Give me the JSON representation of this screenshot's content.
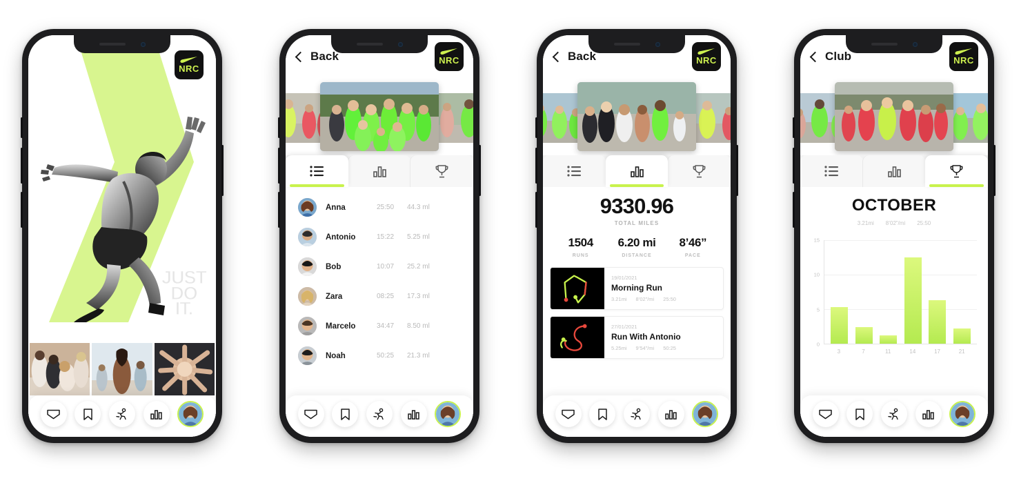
{
  "app": {
    "brand_logo": "nike-nrc-logo",
    "brand_text": "NRC",
    "accent": "#c8f24c",
    "dark": "#111111"
  },
  "screens": [
    {
      "id": "home",
      "hero": {
        "tagline_lines": [
          "JUST",
          "DO",
          "IT."
        ],
        "background_shape": "lime-chevron",
        "image": "runner-sprinting"
      },
      "photo_strip": [
        "friends-stretching",
        "woman-running-beach",
        "hands-together-team"
      ]
    },
    {
      "id": "leaderboard",
      "header": {
        "back_label": "Back",
        "back_icon": "chevron-left-icon"
      },
      "tabs": [
        {
          "icon": "list-icon",
          "name": "leaderboard",
          "active": true
        },
        {
          "icon": "bar-chart-icon",
          "name": "activity",
          "active": false
        },
        {
          "icon": "trophy-icon",
          "name": "challenges",
          "active": false
        }
      ],
      "leaderboard": {
        "columns": [
          "avatar",
          "name",
          "time",
          "distance"
        ],
        "rows": [
          {
            "name": "Anna",
            "time": "25:50",
            "distance": "44.3 ml"
          },
          {
            "name": "Antonio",
            "time": "15:22",
            "distance": "5.25 ml"
          },
          {
            "name": "Bob",
            "time": "10:07",
            "distance": "25.2 ml"
          },
          {
            "name": "Zara",
            "time": "08:25",
            "distance": "17.3 ml"
          },
          {
            "name": "Marcelo",
            "time": "34:47",
            "distance": "8.50 ml"
          },
          {
            "name": "Noah",
            "time": "50:25",
            "distance": "21.3 ml"
          }
        ]
      }
    },
    {
      "id": "activity",
      "header": {
        "back_label": "Back",
        "back_icon": "chevron-left-icon"
      },
      "tabs": [
        {
          "icon": "list-icon",
          "name": "leaderboard",
          "active": false
        },
        {
          "icon": "bar-chart-icon",
          "name": "activity",
          "active": true
        },
        {
          "icon": "trophy-icon",
          "name": "challenges",
          "active": false
        }
      ],
      "summary": {
        "total_value": "9330.96",
        "total_label": "TOTAL MILES",
        "metrics": [
          {
            "value": "1504",
            "label": "RUNS"
          },
          {
            "value": "6.20 mi",
            "label": "DISTANCE"
          },
          {
            "value": "8’46”",
            "label": "PACE"
          }
        ]
      },
      "runs": [
        {
          "date": "19/01/2021",
          "title": "Morning Run",
          "distance": "3.21mi",
          "pace": "8’02”/mi",
          "time": "25:50",
          "route": "gps-route-loop"
        },
        {
          "date": "27/01/2021",
          "title": "Run With Antonio",
          "distance": "5.25mi",
          "pace": "9’54”/mi",
          "time": "50:25",
          "route": "gps-route-s-curve"
        }
      ]
    },
    {
      "id": "club",
      "header": {
        "back_label": "Club",
        "back_icon": "chevron-left-icon"
      },
      "tabs": [
        {
          "icon": "list-icon",
          "name": "leaderboard",
          "active": false
        },
        {
          "icon": "bar-chart-icon",
          "name": "activity",
          "active": false
        },
        {
          "icon": "trophy-icon",
          "name": "challenges",
          "active": true
        }
      ],
      "chart_header": {
        "title": "OCTOBER",
        "stats": [
          "3.21mi",
          "8’02”/mi",
          "25:50"
        ]
      }
    }
  ],
  "bottom_nav": [
    {
      "icon": "shield-badge-icon",
      "name": "feed"
    },
    {
      "icon": "bookmark-icon",
      "name": "saved"
    },
    {
      "icon": "runner-icon",
      "name": "run"
    },
    {
      "icon": "bar-chart-icon",
      "name": "stats"
    },
    {
      "icon": "avatar-icon",
      "name": "profile"
    }
  ],
  "chart_data": {
    "type": "bar",
    "title": "OCTOBER",
    "subtitle": "3.21mi  8'02\"/mi  25:50",
    "categories": [
      "3",
      "7",
      "11",
      "14",
      "17",
      "21"
    ],
    "values": [
      5.3,
      2.4,
      1.2,
      12.5,
      6.3,
      2.2
    ],
    "xlabel": "",
    "ylabel": "",
    "ylim": [
      0,
      15
    ],
    "yticks": [
      0,
      5,
      10,
      15
    ],
    "grid": true,
    "legend": false,
    "bar_color_top": "#dcf87d",
    "bar_color_bottom": "#b4ea50"
  }
}
